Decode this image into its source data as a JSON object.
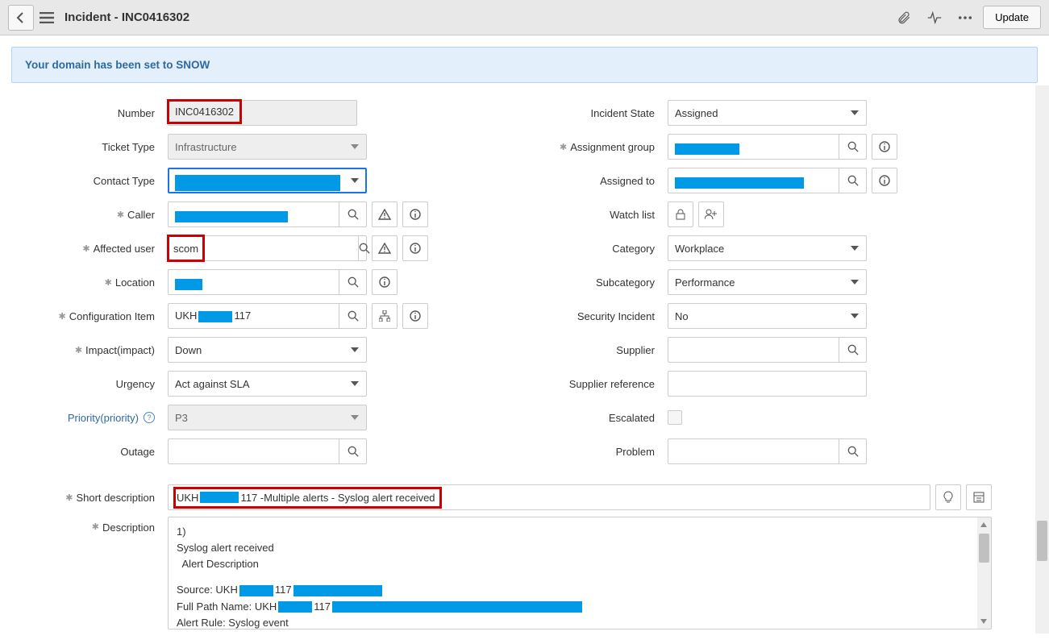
{
  "header": {
    "title": "Incident - INC0416302",
    "buttons": {
      "update": "Update"
    }
  },
  "banner": {
    "text": "Your domain has been set to SNOW"
  },
  "labels": {
    "number": "Number",
    "ticket_type": "Ticket Type",
    "contact_type": "Contact Type",
    "caller": "Caller",
    "affected_user": "Affected user",
    "location": "Location",
    "configuration_item": "Configuration Item",
    "impact": "Impact(impact)",
    "urgency": "Urgency",
    "priority": "Priority(priority)",
    "outage": "Outage",
    "incident_state": "Incident State",
    "assignment_group": "Assignment group",
    "assigned_to": "Assigned to",
    "watch_list": "Watch list",
    "category": "Category",
    "subcategory": "Subcategory",
    "security_incident": "Security Incident",
    "supplier": "Supplier",
    "supplier_reference": "Supplier reference",
    "escalated": "Escalated",
    "problem": "Problem",
    "short_description": "Short description",
    "description": "Description"
  },
  "values": {
    "number": "INC0416302",
    "ticket_type": "Infrastructure",
    "contact_type": "",
    "caller": "",
    "affected_user": "scom",
    "location": "",
    "ci_pre": "UKH",
    "ci_suf": "117",
    "impact": "Down",
    "urgency": "Act against SLA",
    "priority": "P3",
    "outage": "",
    "incident_state": "Assigned",
    "assignment_group": "",
    "assigned_to": "",
    "category": "Workplace",
    "subcategory": "Performance",
    "security_incident": "No",
    "supplier": "",
    "supplier_reference": "",
    "problem": "",
    "short_desc_pre": "UKH",
    "short_desc_suf": "117 -Multiple alerts - Syslog alert received"
  },
  "description": {
    "l1": "1)",
    "l2": "Syslog alert received",
    "l3": "  Alert Description",
    "src_label": "Source:    UKH",
    "src_suf": "117",
    "fpn_label": "Full Path Name:    UKH",
    "fpn_suf": "117",
    "rule_label": "Alert Rule:    Syslog event"
  }
}
